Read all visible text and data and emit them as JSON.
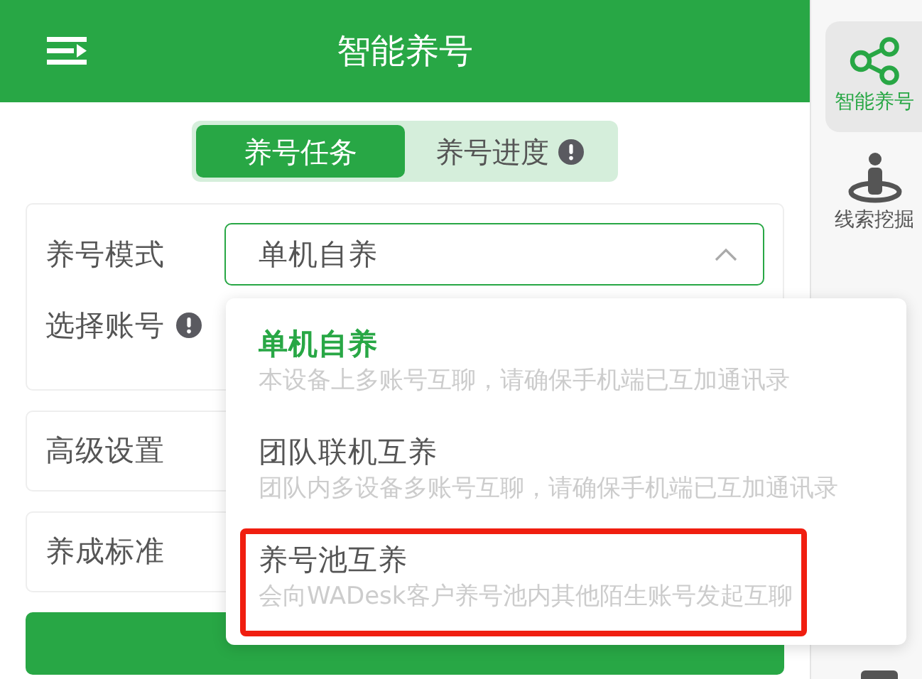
{
  "header": {
    "title": "智能养号"
  },
  "tabs": [
    {
      "label": "养号任务",
      "selected": true,
      "info": false
    },
    {
      "label": "养号进度",
      "selected": false,
      "info": true
    }
  ],
  "form": {
    "mode_label": "养号模式",
    "mode_value": "单机自养",
    "account_label": "选择账号",
    "account_info": true
  },
  "sections": [
    {
      "label": "高级设置"
    },
    {
      "label": "养成标准"
    }
  ],
  "dropdown": {
    "options": [
      {
        "title": "单机自养",
        "description": "本设备上多账号互聊，请确保手机端已互加通讯录",
        "selected": true,
        "highlighted": false
      },
      {
        "title": "团队联机互养",
        "description": "团队内多设备多账号互聊，请确保手机端已互加通讯录",
        "selected": false,
        "highlighted": false
      },
      {
        "title": "养号池互养",
        "description": "会向WADesk客户养号池内其他陌生账号发起互聊",
        "selected": false,
        "highlighted": true
      }
    ]
  },
  "sidebar": {
    "items": [
      {
        "kind": "share",
        "label": "智能养号",
        "selected": true
      },
      {
        "kind": "person",
        "label": "线索挖掘",
        "selected": false
      }
    ]
  }
}
